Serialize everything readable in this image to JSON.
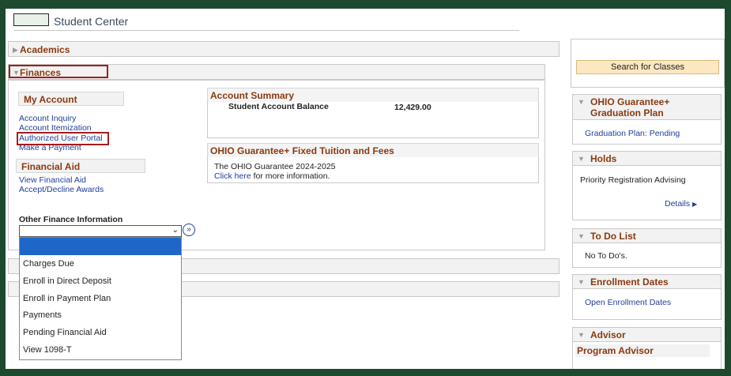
{
  "header": {
    "title": "Student Center"
  },
  "sections": {
    "academics": "Academics",
    "finances": "Finances"
  },
  "finances": {
    "my_account": {
      "heading": "My Account",
      "links": [
        "Account Inquiry",
        "Account Itemization",
        "Authorized User Portal",
        "Make a Payment"
      ]
    },
    "financial_aid": {
      "heading": "Financial Aid",
      "links": [
        "View Financial Aid",
        "Accept/Decline Awards"
      ]
    },
    "other": {
      "label": "Other Finance Information",
      "selected": "",
      "options": [
        "",
        "Charges Due",
        "Enroll in Direct Deposit",
        "Enroll in Payment Plan",
        "Payments",
        "Pending Financial Aid",
        "View 1098-T"
      ],
      "go_glyph": "»"
    },
    "account_summary": {
      "heading": "Account Summary",
      "balance_label": "Student Account Balance",
      "balance_value": "12,429.00"
    },
    "guarantee": {
      "heading": "OHIO Guarantee+ Fixed Tuition and Fees",
      "line1": "The OHIO Guarantee 2024-2025",
      "link": "Click here",
      "line2_suffix": " for more information."
    }
  },
  "sidebar": {
    "search_button": "Search for Classes",
    "graduation": {
      "heading": "OHIO Guarantee+ Graduation Plan",
      "link": "Graduation Plan: Pending"
    },
    "holds": {
      "heading": "Holds",
      "item": "Priority Registration Advising",
      "details": "Details"
    },
    "todo": {
      "heading": "To Do List",
      "item": "No To Do's."
    },
    "enrollment": {
      "heading": "Enrollment Dates",
      "link": "Open Enrollment Dates"
    },
    "advisor": {
      "heading": "Advisor",
      "subheading": "Program Advisor"
    }
  },
  "colors": {
    "frame": "#1d4a2e",
    "section_heading": "#8a3a10",
    "link": "#1f3f9a",
    "highlight": "#a31d1d",
    "dropdown_selected": "#1f66c9"
  }
}
